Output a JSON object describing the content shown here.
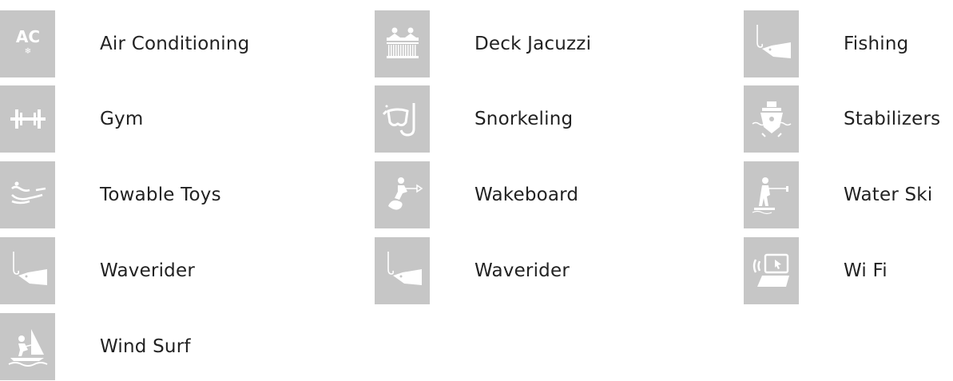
{
  "colors": {
    "tile_background": "#c6c6c6",
    "icon_foreground": "#ffffff",
    "label_text": "#222222"
  },
  "amenities": [
    {
      "label": "Air Conditioning",
      "icon": "air-conditioning-icon",
      "icon_text": "AC",
      "icon_subtext": "❄"
    },
    {
      "label": "Deck Jacuzzi",
      "icon": "deck-jacuzzi-icon"
    },
    {
      "label": "Fishing",
      "icon": "fishing-icon"
    },
    {
      "label": "Gym",
      "icon": "gym-dumbbell-icon"
    },
    {
      "label": "Snorkeling",
      "icon": "snorkel-mask-icon"
    },
    {
      "label": "Stabilizers",
      "icon": "stabilizers-boat-icon"
    },
    {
      "label": "Towable Toys",
      "icon": "towable-toy-icon"
    },
    {
      "label": "Wakeboard",
      "icon": "wakeboard-icon"
    },
    {
      "label": "Water Ski",
      "icon": "water-ski-icon"
    },
    {
      "label": "Waverider",
      "icon": "fishing-icon"
    },
    {
      "label": "Waverider",
      "icon": "fishing-icon"
    },
    {
      "label": "Wi Fi",
      "icon": "wifi-laptop-icon"
    },
    {
      "label": "Wind Surf",
      "icon": "wind-surf-icon"
    }
  ]
}
